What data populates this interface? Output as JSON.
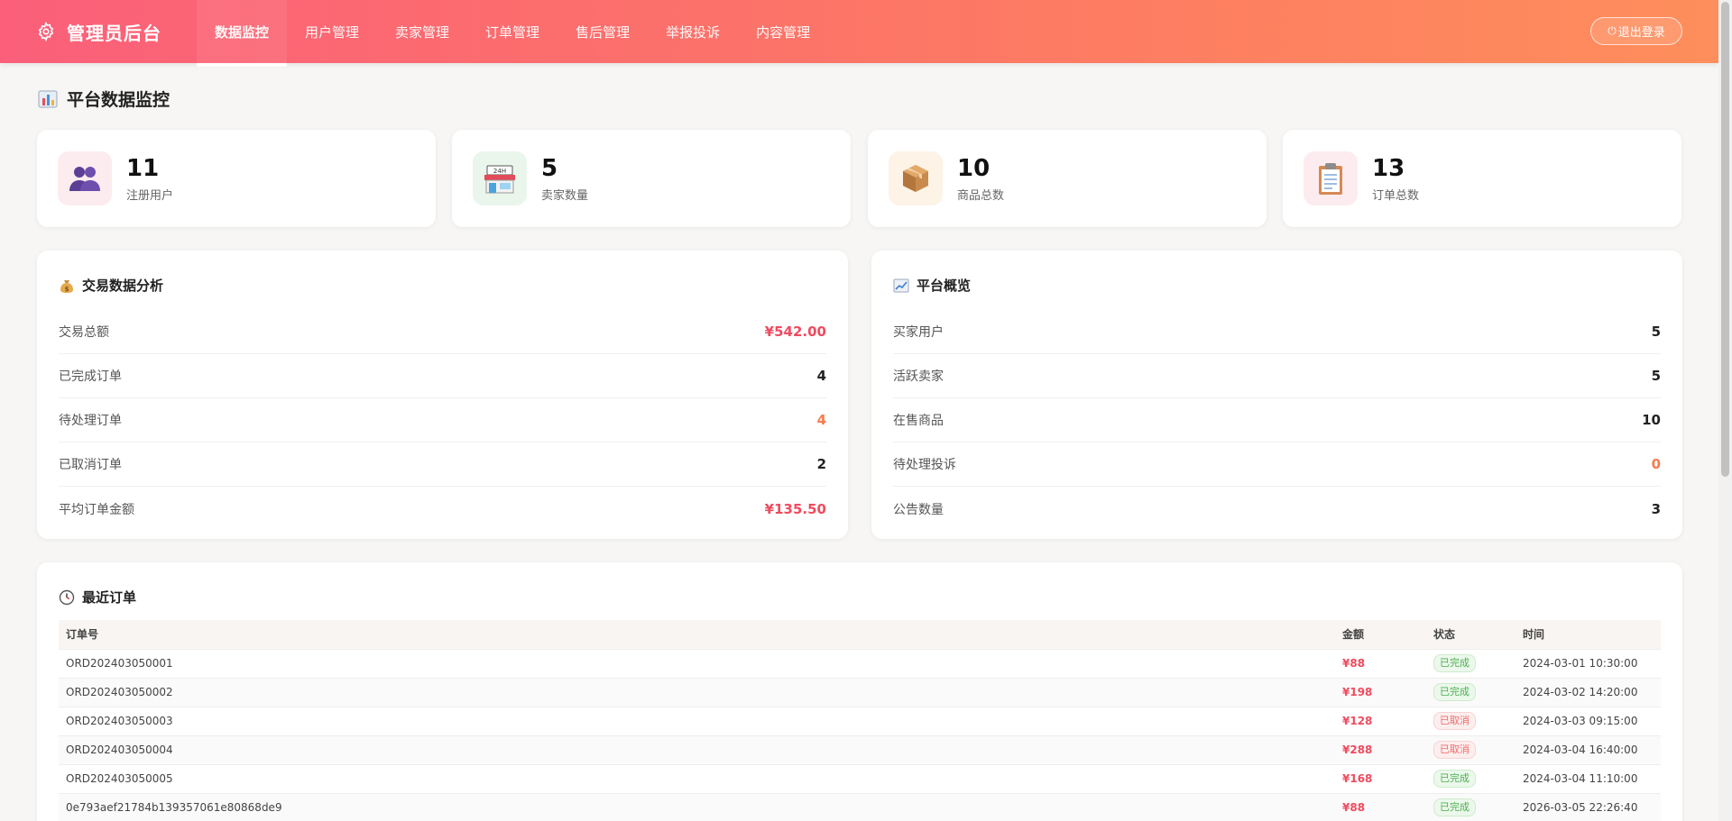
{
  "header": {
    "brand_title": "管理员后台",
    "nav": [
      "数据监控",
      "用户管理",
      "卖家管理",
      "订单管理",
      "售后管理",
      "举报投诉",
      "内容管理"
    ],
    "active_nav": "数据监控",
    "logout_label": "退出登录"
  },
  "page": {
    "title": "平台数据监控"
  },
  "stats": [
    {
      "value": "11",
      "label": "注册用户",
      "icon": "users-icon"
    },
    {
      "value": "5",
      "label": "卖家数量",
      "icon": "store-icon"
    },
    {
      "value": "10",
      "label": "商品总数",
      "icon": "package-icon"
    },
    {
      "value": "13",
      "label": "订单总数",
      "icon": "clipboard-icon"
    }
  ],
  "trade": {
    "title": "交易数据分析",
    "rows": [
      {
        "label": "交易总额",
        "value": "¥542.00"
      },
      {
        "label": "已完成订单",
        "value": "4"
      },
      {
        "label": "待处理订单",
        "value": "4"
      },
      {
        "label": "已取消订单",
        "value": "2"
      },
      {
        "label": "平均订单金额",
        "value": "¥135.50"
      }
    ]
  },
  "overview": {
    "title": "平台概览",
    "rows": [
      {
        "label": "买家用户",
        "value": "5"
      },
      {
        "label": "活跃卖家",
        "value": "5"
      },
      {
        "label": "在售商品",
        "value": "10"
      },
      {
        "label": "待处理投诉",
        "value": "0"
      },
      {
        "label": "公告数量",
        "value": "3"
      }
    ]
  },
  "orders": {
    "title": "最近订单",
    "columns": [
      "订单号",
      "金额",
      "状态",
      "时间"
    ],
    "rows": [
      {
        "id": "ORD202403050001",
        "amount": "¥88",
        "status": "已完成",
        "time": "2024-03-01 10:30:00"
      },
      {
        "id": "ORD202403050002",
        "amount": "¥198",
        "status": "已完成",
        "time": "2024-03-02 14:20:00"
      },
      {
        "id": "ORD202403050003",
        "amount": "¥128",
        "status": "已取消",
        "time": "2024-03-03 09:15:00"
      },
      {
        "id": "ORD202403050004",
        "amount": "¥288",
        "status": "已取消",
        "time": "2024-03-04 16:40:00"
      },
      {
        "id": "ORD202403050005",
        "amount": "¥168",
        "status": "已完成",
        "time": "2024-03-04 11:10:00"
      },
      {
        "id": "0e793aef21784b139357061e80868de9",
        "amount": "¥88",
        "status": "已完成",
        "time": "2026-03-05 22:26:40"
      }
    ]
  },
  "colors": {
    "accent_start": "#fb5f7a",
    "accent_end": "#fe8e5c",
    "money": "#ef4b5f",
    "warning": "#fb7a4b"
  }
}
